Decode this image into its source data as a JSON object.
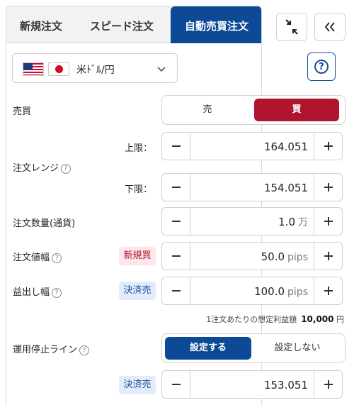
{
  "tabs": [
    "新規注文",
    "スピード注文",
    "自動売買注文"
  ],
  "pair": {
    "label": "米ﾄﾞﾙ/円"
  },
  "help_symbol": "?",
  "question_symbol": "?",
  "rows": {
    "side_label": "売買",
    "sell": "売",
    "buy": "買",
    "range_label": "注文レンジ",
    "upper_label": "上限：",
    "upper_value": "164.051",
    "lower_label": "下限：",
    "lower_value": "154.051",
    "qty_label": "注文数量(通貨)",
    "qty_value": "1.0",
    "qty_unit": "万",
    "width_label": "注文値幅",
    "width_badge": "新規買",
    "width_value": "50.0",
    "width_unit": "pips",
    "tp_label": "益出し幅",
    "tp_badge": "決済売",
    "tp_value": "100.0",
    "tp_unit": "pips",
    "profit_text": "1注文あたりの想定利益額",
    "profit_value": "10,000",
    "profit_unit": "円",
    "stop_label": "運用停止ライン",
    "stop_on": "設定する",
    "stop_off": "設定しない",
    "stop_badge": "決済売",
    "stop_value": "153.051"
  },
  "colors": {
    "tab_active": "#0c4a97",
    "buy_active": "#b1142d",
    "stop_on_active": "#0c4a97"
  },
  "icons": [
    "chevron-down-icon",
    "minimize-icon",
    "double-chevron-left-icon",
    "help-icon",
    "minus-icon",
    "plus-icon"
  ]
}
